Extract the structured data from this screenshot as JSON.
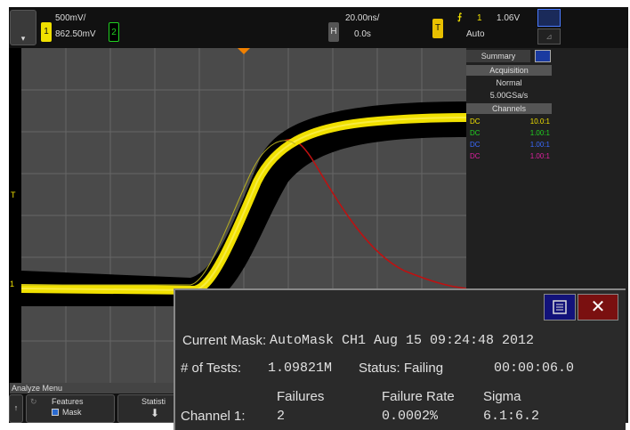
{
  "channel1": {
    "number": "1",
    "scale": "500mV/",
    "offset": "862.50mV",
    "color": "#f0e000"
  },
  "channel2": {
    "number": "2",
    "color": "#20d020"
  },
  "horizontal": {
    "label": "H",
    "timebase": "20.00ns/",
    "delay": "0.0s"
  },
  "trigger": {
    "label": "T",
    "slope_icon": "rising-edge-icon",
    "source": "1",
    "level": "1.06V",
    "mode": "Auto"
  },
  "panel": {
    "summary_tab": "Summary",
    "acquisition_header": "Acquisition",
    "acq_mode": "Normal",
    "sample_rate": "5.00GSa/s",
    "channels_header": "Channels",
    "channels": [
      {
        "coupling": "DC",
        "probe": "10.0:1",
        "color": "#f0e000"
      },
      {
        "coupling": "DC",
        "probe": "1.00:1",
        "color": "#20d020"
      },
      {
        "coupling": "DC",
        "probe": "1.00:1",
        "color": "#3a6aff"
      },
      {
        "coupling": "DC",
        "probe": "1.00:1",
        "color": "#e020a0"
      }
    ]
  },
  "markers": {
    "trigger_level": "T",
    "ch1_ground": "1"
  },
  "softkeys": {
    "menu_title": "Analyze Menu",
    "features_label": "Features",
    "mask_label": "Mask",
    "statistics_label": "Statisti"
  },
  "dialog": {
    "current_mask_label": "Current Mask:",
    "current_mask_value": "AutoMask CH1 Aug 15 09:24:48 2012",
    "tests_label": "# of Tests:",
    "tests_value": "1.09821M",
    "status_label": "Status: Failing",
    "elapsed": "00:00:06.0",
    "col_failures": "Failures",
    "col_failure_rate": "Failure Rate",
    "col_sigma": "Sigma",
    "row_label": "Channel 1:",
    "failures": "2",
    "failure_rate": "0.0002%",
    "sigma": "6.1:6.2"
  }
}
